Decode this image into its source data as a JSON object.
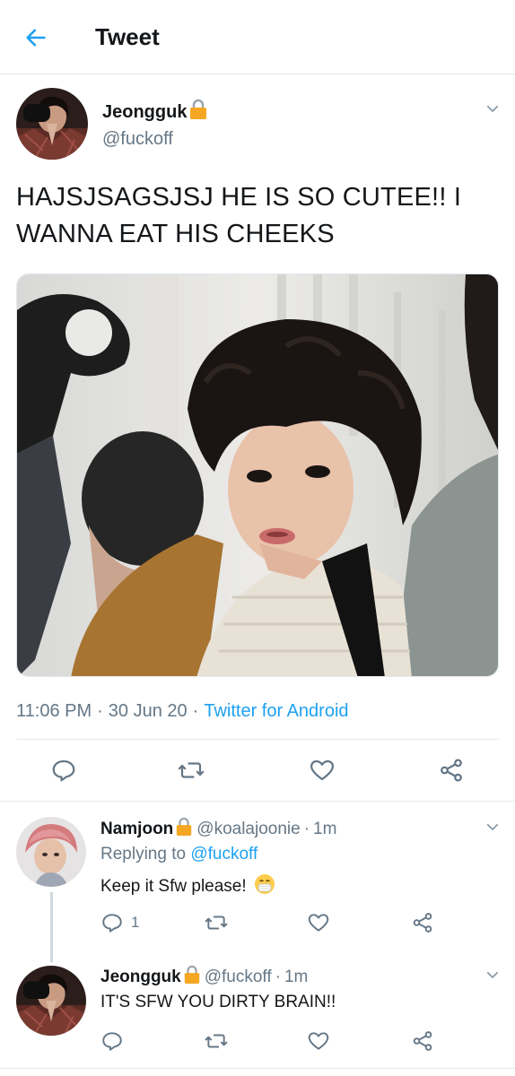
{
  "header": {
    "title": "Tweet"
  },
  "main_tweet": {
    "display_name": "Jeongguk",
    "handle": "@fuckoff",
    "text": "HAJSJSAGSJSJ HE IS SO CUTEE!! I WANNA EAT HIS CHEEKS",
    "time": "11:06 PM",
    "date": "30 Jun 20",
    "separator": "·",
    "source": "Twitter for Android"
  },
  "replies": [
    {
      "display_name": "Namjoon",
      "handle": "@koalajoonie",
      "time_sep": "·",
      "time": "1m",
      "replying_label": "Replying to",
      "replying_to": "@fuckoff",
      "text": "Keep it Sfw please!",
      "emoji": "😷",
      "reply_count": "1"
    },
    {
      "display_name": "Jeongguk",
      "handle": "@fuckoff",
      "time_sep": "·",
      "time": "1m",
      "text": "IT'S SFW YOU DIRTY BRAIN!!"
    }
  ],
  "colors": {
    "accent": "#1da1f2",
    "secondary_text": "#657786",
    "primary_text": "#14171a",
    "divider": "#e1e8ed",
    "lock": "#f5a623"
  },
  "icons": [
    "back-arrow-icon",
    "lock-icon",
    "chevron-down-icon",
    "reply-icon",
    "retweet-icon",
    "like-icon",
    "share-icon"
  ]
}
